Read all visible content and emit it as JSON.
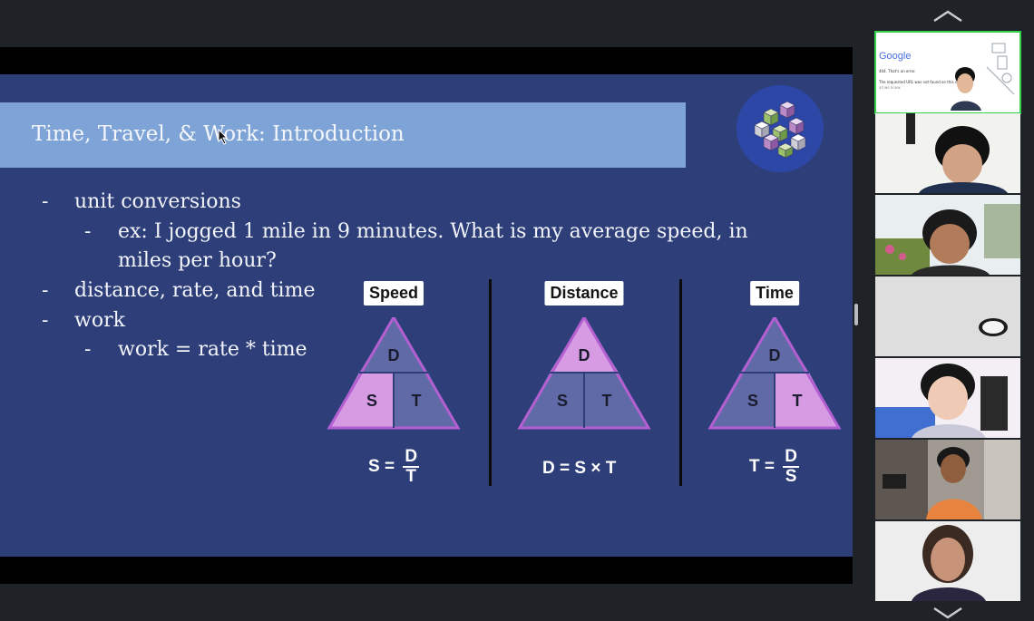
{
  "slide": {
    "title": "Time, Travel, & Work: Introduction",
    "bullets": [
      {
        "level": 1,
        "dash": "-",
        "text": "unit conversions"
      },
      {
        "level": 2,
        "dash": "-",
        "text": "ex: I jogged 1 mile in 9 minutes. What is my average speed, in"
      },
      {
        "level": 2,
        "dash": "",
        "text": "miles per hour?"
      },
      {
        "level": 1,
        "dash": "-",
        "text": "distance, rate, and time"
      },
      {
        "level": 1,
        "dash": "-",
        "text": "work"
      },
      {
        "level": 2,
        "dash": "-",
        "text": "work = rate * time"
      }
    ],
    "diagrams": [
      {
        "label": "Speed",
        "top": "D",
        "left": "S",
        "right": "T",
        "highlight": "left",
        "formula_lhs": "S =",
        "num": "D",
        "den": "T"
      },
      {
        "label": "Distance",
        "top": "D",
        "left": "S",
        "right": "T",
        "highlight": "top",
        "formula": "D = S × T"
      },
      {
        "label": "Time",
        "top": "D",
        "left": "S",
        "right": "T",
        "highlight": "right",
        "formula_lhs": "T =",
        "num": "D",
        "den": "S"
      }
    ],
    "colors": {
      "highlight": "#d79be4",
      "muted": "#5f6aa7",
      "outline": "#b45fd1",
      "background": "#2d3e79",
      "title_band": "#7ea3d6"
    }
  },
  "participants": [
    {
      "name": "presenter-tile",
      "active": true,
      "shared_screen_text": [
        "Google",
        "404. That's an error.",
        "The requested URL was not found on this server.",
        "all we know."
      ]
    },
    {
      "name": "participant-2"
    },
    {
      "name": "participant-3"
    },
    {
      "name": "participant-4"
    },
    {
      "name": "participant-5"
    },
    {
      "name": "participant-6"
    },
    {
      "name": "participant-7"
    }
  ],
  "icons": {
    "scroll_up": "chevron-up-icon",
    "scroll_down": "chevron-down-icon"
  }
}
